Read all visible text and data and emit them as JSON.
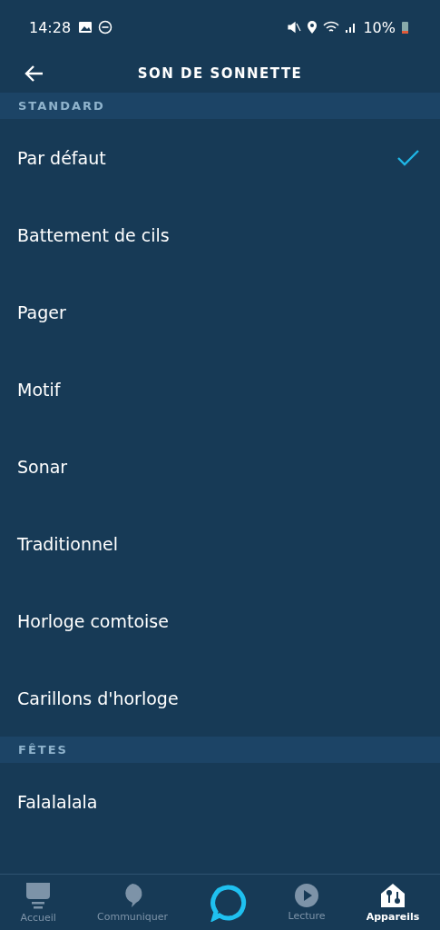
{
  "status_bar": {
    "time": "14:28",
    "battery": "10%"
  },
  "header": {
    "title": "SON DE SONNETTE"
  },
  "sections": [
    {
      "title": "STANDARD",
      "items": [
        {
          "label": "Par défaut",
          "selected": true
        },
        {
          "label": "Battement de cils",
          "selected": false
        },
        {
          "label": "Pager",
          "selected": false
        },
        {
          "label": "Motif",
          "selected": false
        },
        {
          "label": "Sonar",
          "selected": false
        },
        {
          "label": "Traditionnel",
          "selected": false
        },
        {
          "label": "Horloge comtoise",
          "selected": false
        },
        {
          "label": "Carillons d'horloge",
          "selected": false
        }
      ]
    },
    {
      "title": "FÊTES",
      "items": [
        {
          "label": "Falalalala",
          "selected": false
        }
      ]
    }
  ],
  "bottom_nav": [
    {
      "label": "Accueil",
      "kind": "home",
      "selected": false
    },
    {
      "label": "Communiquer",
      "kind": "chat",
      "selected": false
    },
    {
      "kind": "assistant",
      "selected": false
    },
    {
      "label": "Lecture",
      "kind": "play",
      "selected": false
    },
    {
      "label": "Appareils",
      "kind": "devices",
      "selected": true
    }
  ]
}
